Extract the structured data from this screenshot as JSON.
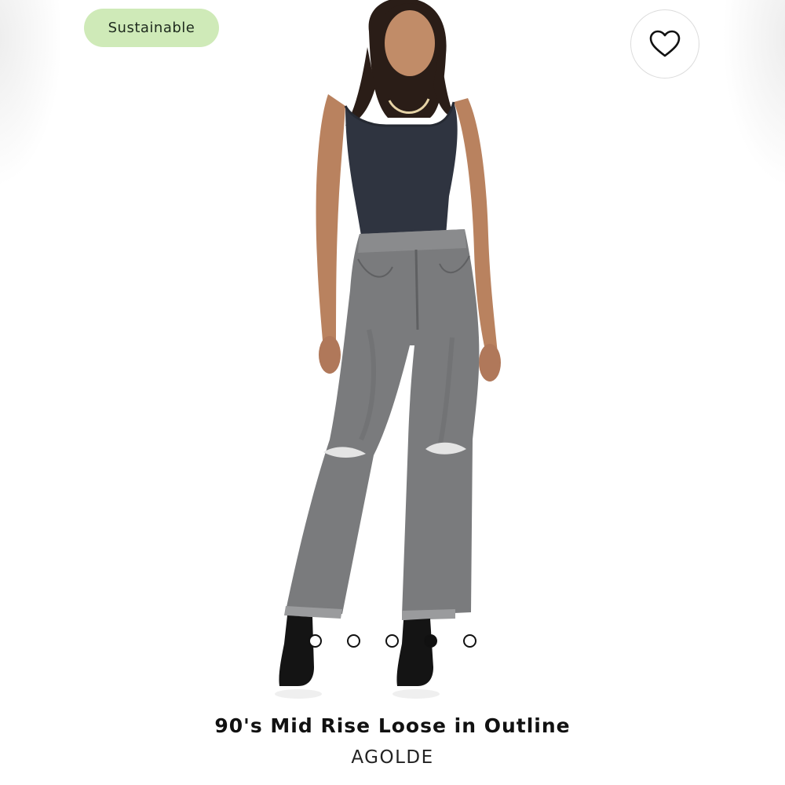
{
  "badge": {
    "label": "Sustainable",
    "color": "#cfeab8"
  },
  "favorite": {
    "icon": "heart-outline-icon"
  },
  "product": {
    "name": "90's Mid Rise Loose in Outline",
    "brand": "AGOLDE",
    "image": "model-wearing-grey-distressed-jeans"
  },
  "carousel": {
    "count": 5,
    "active_index": 3
  }
}
